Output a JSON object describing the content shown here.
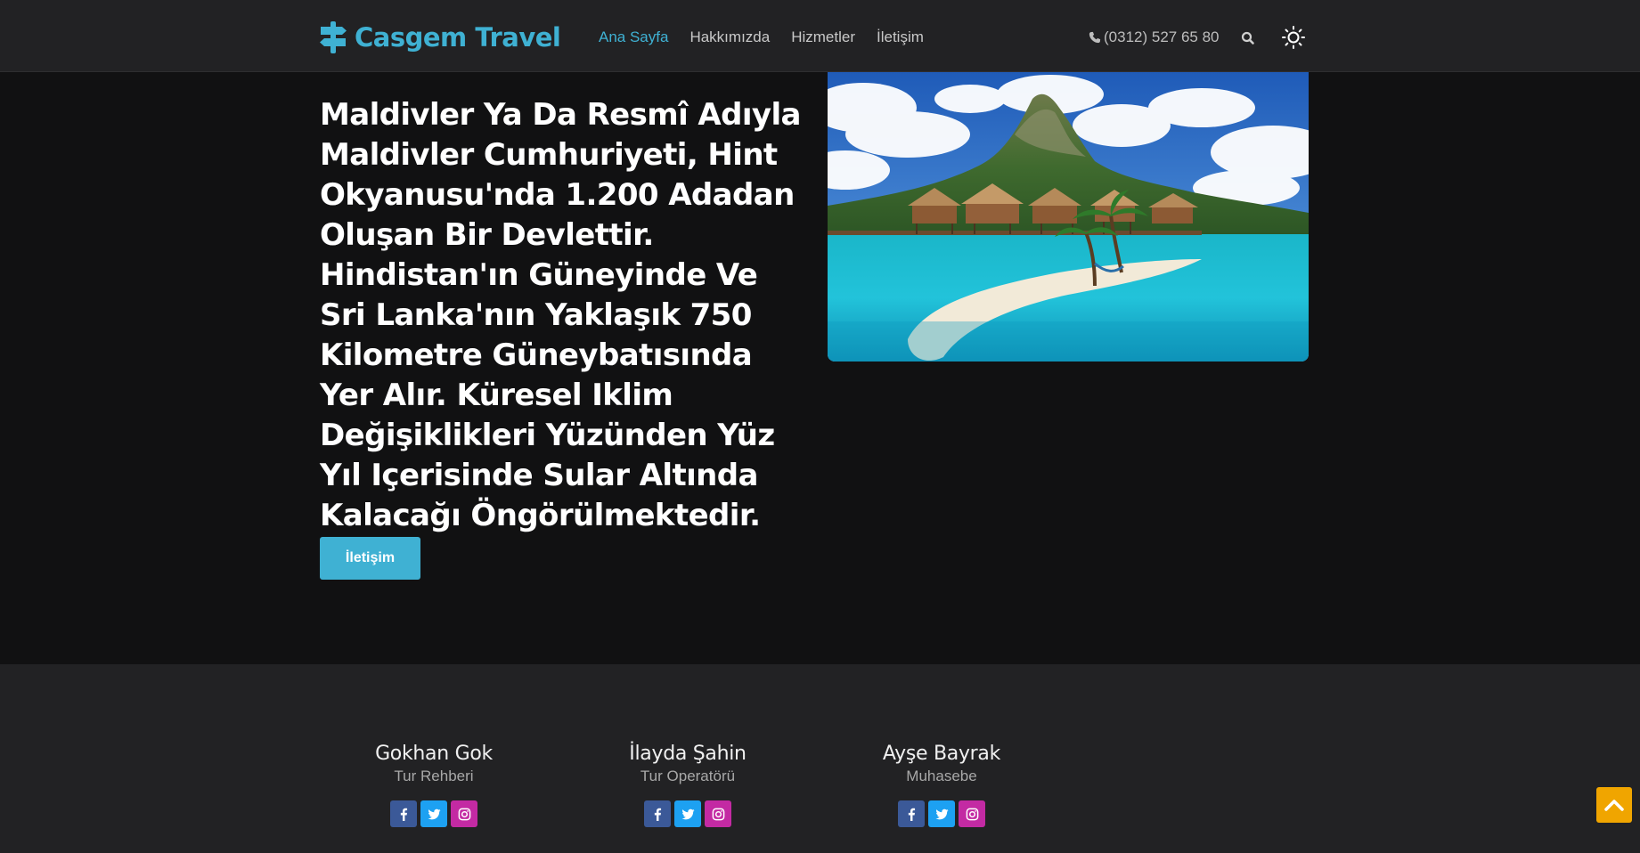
{
  "header": {
    "brand": "Casgem Travel",
    "nav": [
      {
        "label": "Ana Sayfa",
        "active": true
      },
      {
        "label": "Hakkımızda",
        "active": false
      },
      {
        "label": "Hizmetler",
        "active": false
      },
      {
        "label": "İletişim",
        "active": false
      }
    ],
    "phone": "(0312) 527 65 80",
    "icons": {
      "phone": "phone-icon",
      "search": "search-icon",
      "theme": "sun-icon"
    }
  },
  "hero": {
    "title": "Maldivler Ya Da Resmî Adıyla Maldivler Cumhuriyeti, Hint Okyanusu'nda 1.200 Adadan Oluşan Bir Devlettir. Hindistan'ın Güneyinde Ve Sri Lanka'nın Yaklaşık 750 Kilometre Güneybatısında Yer Alır. Küresel Iklim Değişiklikleri Yüzünden Yüz Yıl Içerisinde Sular Altında Kalacağı Öngörülmektedir.",
    "button": "İletişim"
  },
  "team": [
    {
      "name": "Gokhan Gok",
      "role": "Tur Rehberi"
    },
    {
      "name": "İlayda Şahin",
      "role": "Tur Operatörü"
    },
    {
      "name": "Ayşe Bayrak",
      "role": "Muhasebe"
    }
  ],
  "colors": {
    "accent": "#3fb1d3",
    "nav_bg": "#222224",
    "page_bg": "#111112",
    "scroll_top": "#f0a500",
    "facebook": "#3b5998",
    "twitter": "#1da1f2",
    "instagram": "#c32aa3"
  }
}
